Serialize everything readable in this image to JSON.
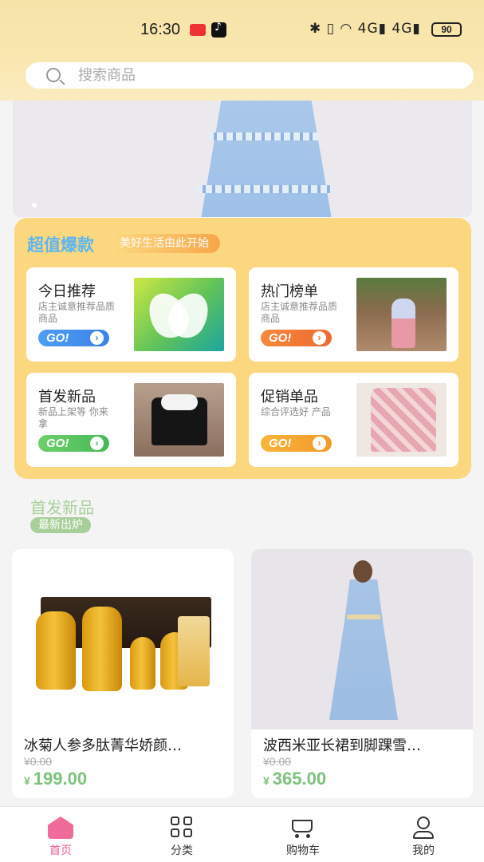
{
  "status_bar": {
    "time": "16:30",
    "icons": "✱ ▯ ◠ 4G▮ 4G▮",
    "battery": "90"
  },
  "search": {
    "placeholder": "搜索商品"
  },
  "deals": {
    "title": "超值爆款",
    "tagline": "美好生活由此开始",
    "go_label": "GO!",
    "go_arrow": "›",
    "cards": [
      {
        "title": "今日推荐",
        "subtitle": "店主诚意推荐品质商品",
        "go_color": "blue"
      },
      {
        "title": "热门榜单",
        "subtitle": "店主诚意推荐品质商品",
        "go_color": "orange"
      },
      {
        "title": "首发新品",
        "subtitle": "新品上架等 你来拿",
        "go_color": "green"
      },
      {
        "title": "促销单品",
        "subtitle": "综合评选好 产品",
        "go_color": "amber"
      }
    ]
  },
  "new_section": {
    "title": "首发新品",
    "tag": "最新出炉"
  },
  "products": [
    {
      "name": "冰菊人参多肽菁华娇颜…",
      "old_price": "¥0.00",
      "currency": "¥",
      "price": "199.00"
    },
    {
      "name": "波西米亚长裙到脚踝雪…",
      "old_price": "¥0.00",
      "currency": "¥",
      "price": "365.00"
    }
  ],
  "nav": {
    "items": [
      {
        "label": "首页",
        "icon": "home-icon",
        "active": true
      },
      {
        "label": "分类",
        "icon": "grid-icon",
        "active": false
      },
      {
        "label": "购物车",
        "icon": "cart-icon",
        "active": false
      },
      {
        "label": "我的",
        "icon": "user-icon",
        "active": false
      }
    ]
  },
  "colors": {
    "header_gradient": "#f6e3a8",
    "deals_panel": "#fbd87f",
    "deals_title": "#5fb6ee",
    "price_green": "#7cc27c",
    "active_pink": "#f05b8e"
  }
}
